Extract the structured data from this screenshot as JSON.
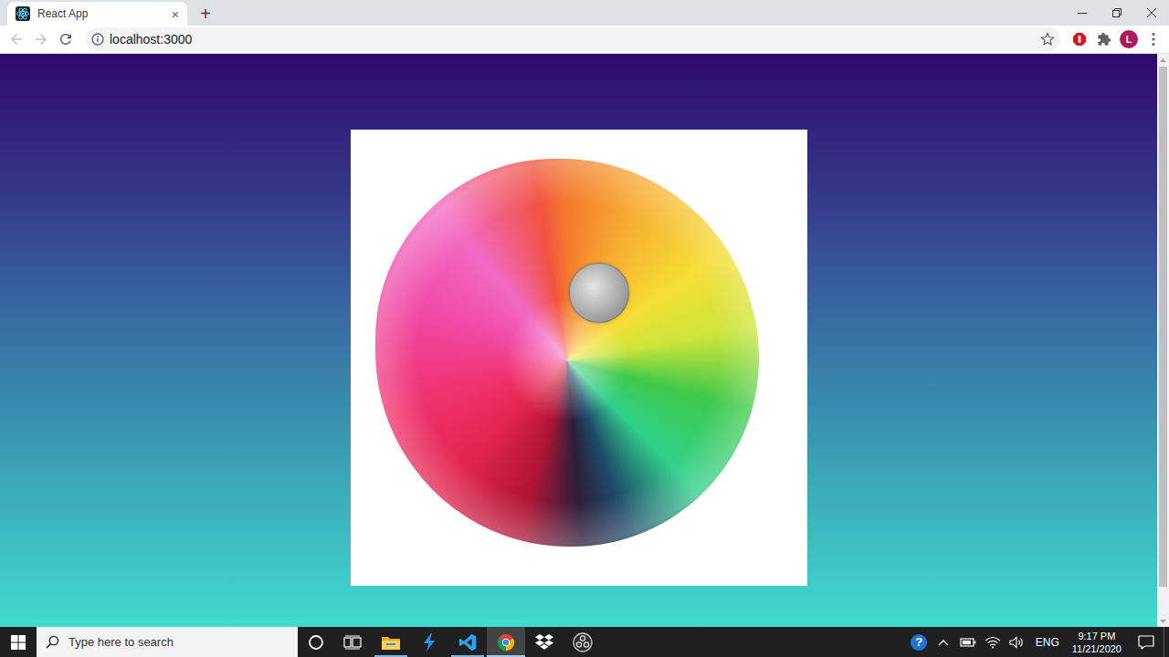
{
  "window": {
    "title": "React App"
  },
  "tabs": [
    {
      "label": "React App",
      "selected": true,
      "close": "×"
    }
  ],
  "new_tab": "+",
  "nav": {
    "back": {
      "disabled": true
    },
    "forward": {
      "disabled": true
    }
  },
  "address_bar": {
    "url": "localhost:3000"
  },
  "profile": {
    "initial": "L"
  },
  "scrollbar": {
    "level": 0.95
  },
  "taskbar": {
    "search": {
      "placeholder": "Type here to search"
    },
    "apps": [
      {
        "kind": "explorer",
        "running": true,
        "selected": false
      },
      {
        "kind": "bolt",
        "running": false,
        "selected": false
      },
      {
        "kind": "vscode",
        "running": true,
        "selected": false
      },
      {
        "kind": "chrome",
        "running": true,
        "selected": true
      },
      {
        "kind": "dropbox",
        "running": false,
        "selected": false
      },
      {
        "kind": "obs",
        "running": false,
        "selected": false
      }
    ],
    "help": "?",
    "language": "ENG",
    "time": "9:17 PM",
    "date": "11/21/2020"
  }
}
